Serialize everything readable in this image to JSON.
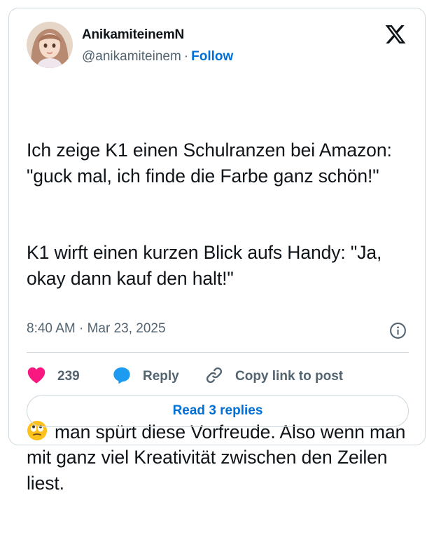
{
  "author": {
    "display_name": "AnikamiteinemN",
    "handle": "@anikamiteinem",
    "separator": "·",
    "follow_label": "Follow"
  },
  "tweet": {
    "paragraph1": "Ich zeige K1 einen Schulranzen bei Amazon: \"guck mal, ich finde die Farbe ganz schön!\"",
    "paragraph2": "K1 wirft einen kurzen Blick aufs Handy: \"Ja, okay dann kauf den halt!\"",
    "paragraph3_emoji": "face-with-rolling-eyes-emoji",
    "paragraph3": "man spürt diese Vorfreude. Also wenn man mit ganz viel Kreativität zwischen den Zeilen liest."
  },
  "meta": {
    "time": "8:40 AM",
    "separator": "·",
    "date": "Mar 23, 2025"
  },
  "actions": {
    "like_count": "239",
    "reply_label": "Reply",
    "copy_label": "Copy link to post"
  },
  "read_replies_label": "Read 3 replies",
  "colors": {
    "like": "#f91880",
    "reply": "#1d9bf0",
    "link_blue": "#006fd6",
    "secondary_text": "#536471",
    "border": "#cfd9de"
  },
  "icons": [
    "x-logo-icon",
    "heart-icon",
    "reply-bubble-icon",
    "link-icon",
    "info-icon"
  ]
}
